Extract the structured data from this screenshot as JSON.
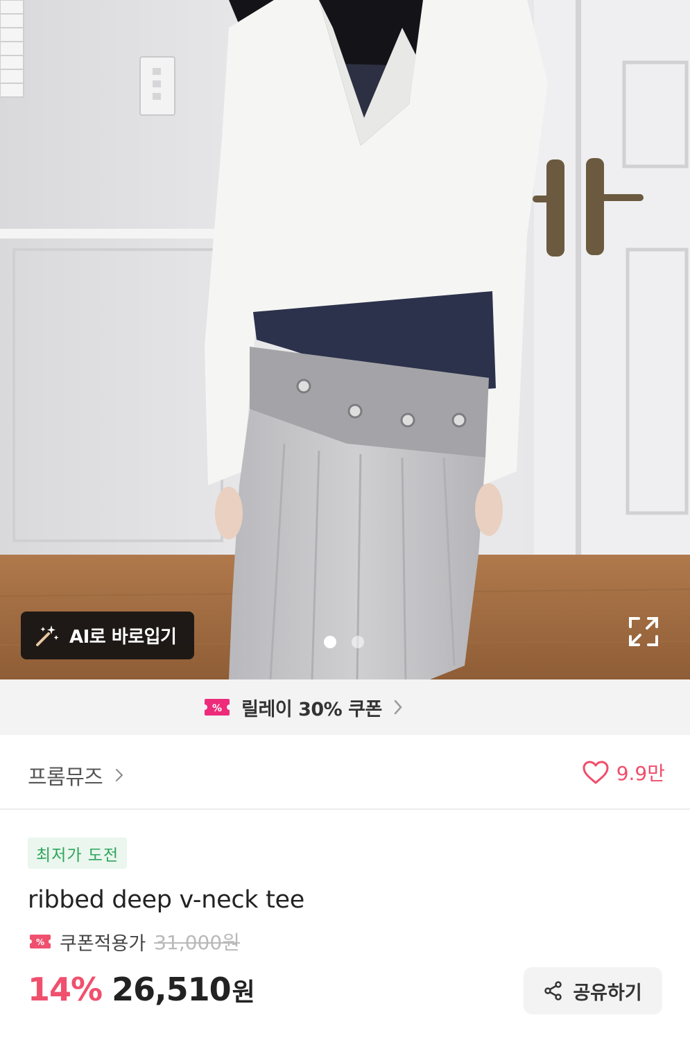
{
  "hero": {
    "ai_button_label": "AI로 바로입기",
    "page_indicator": {
      "total": 2,
      "active": 1
    }
  },
  "coupon_strip": {
    "text": "릴레이 30% 쿠폰"
  },
  "brand": {
    "name": "프롬뮤즈",
    "like_count": "9.9만"
  },
  "product": {
    "badge": "최저가 도전",
    "title": "ribbed deep v-neck tee",
    "coupon_price_label": "쿠폰적용가",
    "original_price": "31,000원",
    "discount": "14%",
    "price": "26,510",
    "currency": "원"
  },
  "share_label": "공유하기",
  "colors": {
    "accent_pink": "#f0506e",
    "coupon_magenta": "#ee2a7b",
    "badge_green": "#2ea55a"
  }
}
